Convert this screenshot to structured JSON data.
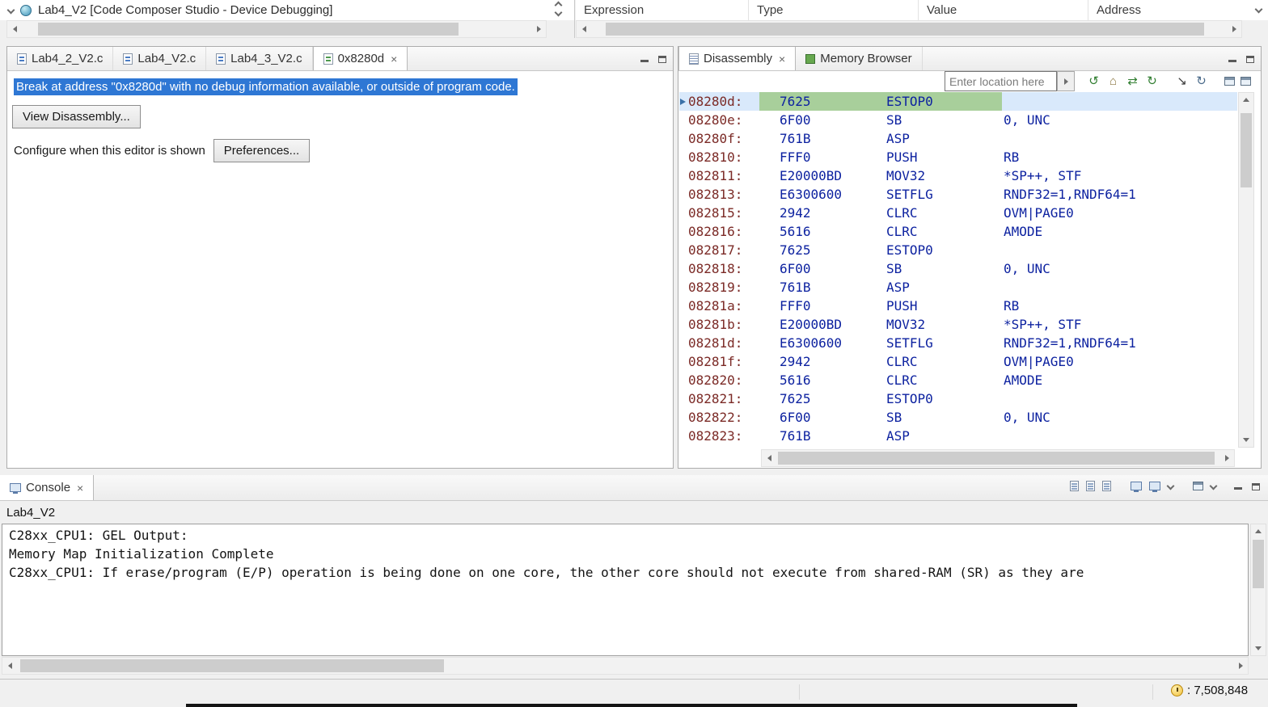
{
  "colors": {
    "selection_blue": "#2E77D4",
    "row_highlight_blue": "#D9E9FB",
    "pc_highlight_green": "#A8CF9B",
    "address_red": "#7B2A26",
    "code_navy": "#0D22A0",
    "chrome_gray": "#F0F0F0"
  },
  "debug": {
    "title": "Lab4_V2 [Code Composer Studio - Device Debugging]"
  },
  "expressions": {
    "columns": [
      "Expression",
      "Type",
      "Value",
      "Address"
    ]
  },
  "editor": {
    "tabs": [
      {
        "label": "Lab4_2_V2.c"
      },
      {
        "label": "Lab4_V2.c"
      },
      {
        "label": "Lab4_3_V2.c"
      },
      {
        "label": "0x8280d"
      }
    ],
    "message": "Break at address \"0x8280d\" with no debug information available, or outside of program code.",
    "view_disassembly_button": "View Disassembly...",
    "configure_label": "Configure when this editor is shown",
    "preferences_button": "Preferences..."
  },
  "disassembly": {
    "tab_label": "Disassembly",
    "memory_tab_label": "Memory Browser",
    "location_input_placeholder": "Enter location here",
    "rows": [
      {
        "address": "08280d:",
        "opcode": "7625",
        "mnemonic": "ESTOP0",
        "operands": "",
        "current": true
      },
      {
        "address": "08280e:",
        "opcode": "6F00",
        "mnemonic": "SB",
        "operands": "0, UNC"
      },
      {
        "address": "08280f:",
        "opcode": "761B",
        "mnemonic": "ASP",
        "operands": ""
      },
      {
        "address": "082810:",
        "opcode": "FFF0",
        "mnemonic": "PUSH",
        "operands": "RB"
      },
      {
        "address": "082811:",
        "opcode": "E20000BD",
        "mnemonic": "MOV32",
        "operands": "*SP++, STF"
      },
      {
        "address": "082813:",
        "opcode": "E6300600",
        "mnemonic": "SETFLG",
        "operands": "RNDF32=1,RNDF64=1"
      },
      {
        "address": "082815:",
        "opcode": "2942",
        "mnemonic": "CLRC",
        "operands": "OVM|PAGE0"
      },
      {
        "address": "082816:",
        "opcode": "5616",
        "mnemonic": "CLRC",
        "operands": "AMODE"
      },
      {
        "address": "082817:",
        "opcode": "7625",
        "mnemonic": "ESTOP0",
        "operands": ""
      },
      {
        "address": "082818:",
        "opcode": "6F00",
        "mnemonic": "SB",
        "operands": "0, UNC"
      },
      {
        "address": "082819:",
        "opcode": "761B",
        "mnemonic": "ASP",
        "operands": ""
      },
      {
        "address": "08281a:",
        "opcode": "FFF0",
        "mnemonic": "PUSH",
        "operands": "RB"
      },
      {
        "address": "08281b:",
        "opcode": "E20000BD",
        "mnemonic": "MOV32",
        "operands": "*SP++, STF"
      },
      {
        "address": "08281d:",
        "opcode": "E6300600",
        "mnemonic": "SETFLG",
        "operands": "RNDF32=1,RNDF64=1"
      },
      {
        "address": "08281f:",
        "opcode": "2942",
        "mnemonic": "CLRC",
        "operands": "OVM|PAGE0"
      },
      {
        "address": "082820:",
        "opcode": "5616",
        "mnemonic": "CLRC",
        "operands": "AMODE"
      },
      {
        "address": "082821:",
        "opcode": "7625",
        "mnemonic": "ESTOP0",
        "operands": ""
      },
      {
        "address": "082822:",
        "opcode": "6F00",
        "mnemonic": "SB",
        "operands": "0, UNC"
      },
      {
        "address": "082823:",
        "opcode": "761B",
        "mnemonic": "ASP",
        "operands": ""
      }
    ]
  },
  "console": {
    "tab_label": "Console",
    "title": "Lab4_V2",
    "lines": [
      "C28xx_CPU1: GEL Output:",
      "Memory Map Initialization Complete",
      "C28xx_CPU1: If erase/program (E/P) operation is being done on one core, the other core should not execute from shared-RAM (SR) as they are"
    ]
  },
  "status_bar": {
    "cycle_count": ": 7,508,848"
  },
  "icons": {
    "close": "×",
    "refresh": "↻",
    "refresh_ccw": "↺",
    "home": "⌂",
    "swap": "⇄",
    "arrow_se": "↘"
  }
}
